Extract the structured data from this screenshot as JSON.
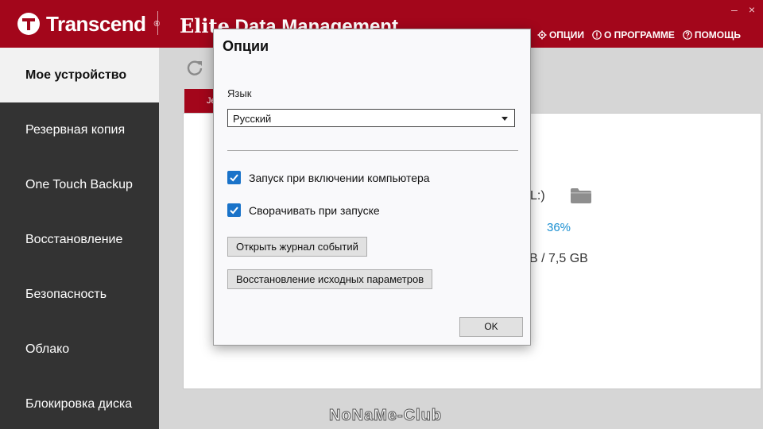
{
  "header": {
    "brand": "Transcend",
    "brand_reg": "®",
    "app_title_prefix": "Elite",
    "app_title_rest": " Data Management",
    "menu": {
      "options": "ОПЦИИ",
      "about": "О ПРОГРАММЕ",
      "help": "ПОМОЩЬ"
    },
    "window": {
      "minimize": "–",
      "close": "×"
    }
  },
  "sidebar": {
    "items": [
      {
        "label": "Мое устройство",
        "active": true
      },
      {
        "label": "Резервная копия"
      },
      {
        "label": "One Touch Backup"
      },
      {
        "label": "Восстановление"
      },
      {
        "label": "Безопасность"
      },
      {
        "label": "Облако"
      },
      {
        "label": "Блокировка диска"
      }
    ]
  },
  "main": {
    "tab_label": "Je",
    "drive_label": "L:)",
    "usage_percent": "36%",
    "capacity": "B / 7,5 GB",
    "watermark": "NoNaMe-Club"
  },
  "dialog": {
    "title": "Опции",
    "language_label": "Язык",
    "language_value": "Русский",
    "checkboxes": [
      {
        "label": "Запуск при включении компьютера",
        "checked": true
      },
      {
        "label": "Сворачивать при запуске",
        "checked": true
      }
    ],
    "open_log_button": "Открыть журнал событий",
    "restore_defaults_button": "Восстановление исходных параметров",
    "ok_button": "OK"
  },
  "colors": {
    "header_red": "#a3061b",
    "sidebar_dark": "#333333",
    "checkbox_blue": "#1a73c9",
    "percent_blue": "#1a8fd1"
  }
}
